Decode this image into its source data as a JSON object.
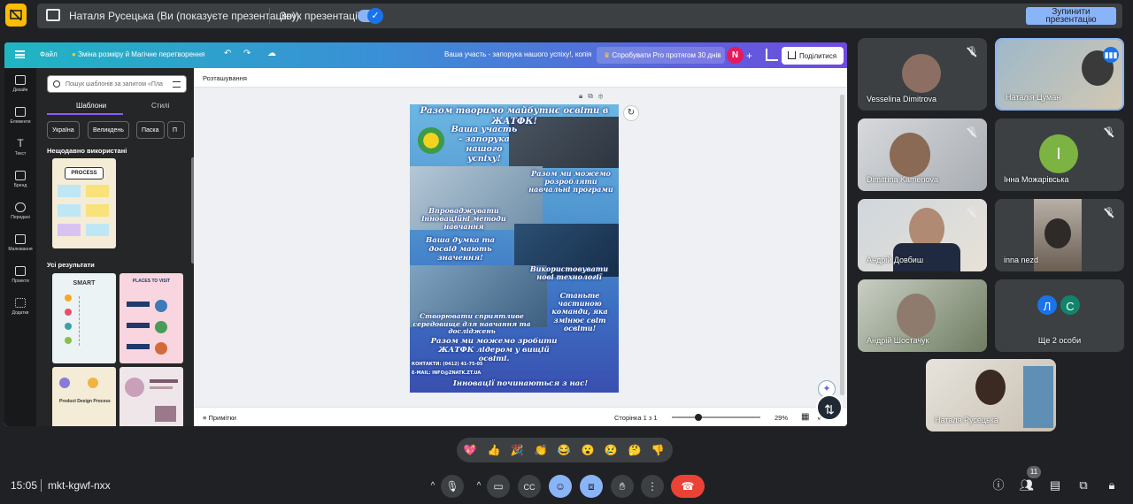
{
  "topbar": {
    "presenting_text": "Наталя Русецька (Ви (показуєте презентацію))",
    "audio_label": "Звук презентації",
    "stop_button": "Зупинити презентацію",
    "audio_enabled": true
  },
  "canva": {
    "header": {
      "file_menu": "Файл",
      "resize_label": "Зміна розміру й Магічне перетворення",
      "doc_title": "Ваша участь - запорука нашого успіху!, копія",
      "try_pro": "Спробувати Pro протягом 30 днів",
      "avatar_initial": "N",
      "plus": "+",
      "share": "Поділитися"
    },
    "rail": [
      {
        "label": "Дизайн",
        "icon": "design-icon"
      },
      {
        "label": "Елементи",
        "icon": "elements-icon"
      },
      {
        "label": "Текст",
        "icon": "text-icon"
      },
      {
        "label": "Бренд",
        "icon": "brand-icon"
      },
      {
        "label": "Передані",
        "icon": "uploads-icon"
      },
      {
        "label": "Малювання",
        "icon": "draw-icon"
      },
      {
        "label": "Проекти",
        "icon": "projects-icon"
      },
      {
        "label": "Додатки",
        "icon": "apps-icon"
      }
    ],
    "panel": {
      "search_placeholder": "Пошук шаблонів за запитом «Пла",
      "tabs": [
        "Шаблони",
        "Стилі"
      ],
      "chips": [
        "Україна",
        "Великдень",
        "Паска",
        "П"
      ],
      "recent_title": "Нещодавно використані",
      "all_results_title": "Усі результати",
      "thumbs": [
        {
          "title": "Template PROCESS",
          "color": "#f4ecd6"
        },
        {
          "title": "SMART",
          "color": "#ecf3f4"
        },
        {
          "title": "PLACES TO VISIT THIS SUMMER",
          "color": "#f9d6df"
        },
        {
          "title": "Product Design Process",
          "color": "#f4ecd6"
        },
        {
          "title": "",
          "color": "#efe6ea"
        }
      ]
    },
    "editor": {
      "position_label": "Розташування",
      "notes_label": "Примітки",
      "page_indicator": "Сторінка 1 з 1",
      "zoom": "29%",
      "zoom_fraction": 0.29
    },
    "poster": {
      "line1": "Разом творимо майбутнє освіти в ЖАТФК!",
      "line2": "Ваша участь - запорука нашого успіху!",
      "line3": "Разом ми можемо розробляти навчальні програми",
      "line4": "Впроваджувати інноваційні методи навчання",
      "line5": "Ваша думка та досвід мають значення!",
      "line6": "Використовувати нові технології",
      "line7": "Станьте частиною команди, яка змінює світ освіти!",
      "line8": "Створювати сприятливе середовище для навчання та досліджень",
      "line9": "Разом ми можемо зробити ЖАТФК лідером у вищій освіті.",
      "contacts": "КОНТАКТИ: (0412) 41-75-05",
      "email": "E-MAIL: INFO@ZNATK.ZT.UA",
      "footer": "Інновації починаються з нас!"
    }
  },
  "participants": [
    {
      "name": "Vesselina Dimitrova",
      "muted": true
    },
    {
      "name": "Наталія Цуман",
      "muted": false,
      "speaking": true
    },
    {
      "name": "Dimitrina Kamenova",
      "muted": true
    },
    {
      "name": "Інна Можарівська",
      "muted": true,
      "initial": "І",
      "color": "#7cb342"
    },
    {
      "name": "Андрій Довбиш",
      "muted": true
    },
    {
      "name": "inna nezd",
      "muted": true
    },
    {
      "name": "Андрій Шостачук",
      "muted": false
    },
    {
      "name": "Ще 2 особи",
      "initials": [
        "Л",
        "С"
      ],
      "colors": [
        "#1a73e8",
        "#12846b"
      ]
    },
    {
      "name": "Наталя Русецька",
      "self": true
    }
  ],
  "reactions": [
    "💖",
    "👍",
    "🎉",
    "👏",
    "😂",
    "😮",
    "😢",
    "🤔",
    "👎"
  ],
  "bottombar": {
    "time": "15:05",
    "meeting_code": "mkt-kgwf-nxx",
    "people_count": "11",
    "caret": "^"
  }
}
